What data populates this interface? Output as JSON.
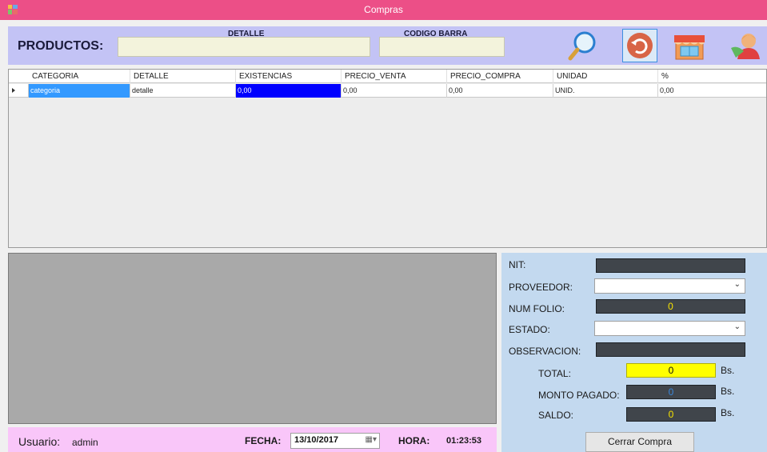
{
  "window": {
    "title": "Compras"
  },
  "products": {
    "heading": "PRODUCTOS:",
    "detail_label": "DETALLE",
    "barcode_label": "CODIGO BARRA",
    "detail_value": "",
    "barcode_value": ""
  },
  "toolbar": {
    "icons": [
      "search-icon",
      "back-icon",
      "store-icon",
      "user-icon"
    ]
  },
  "grid": {
    "columns": [
      "CATEGORIA",
      "DETALLE",
      "EXISTENCIAS",
      "PRECIO_VENTA",
      "PRECIO_COMPRA",
      "UNIDAD",
      "%"
    ],
    "rows": [
      [
        "categoria",
        "detalle",
        "0,00",
        "0,00",
        "0,00",
        "UNID.",
        "0,00"
      ]
    ]
  },
  "form": {
    "nit_label": "NIT:",
    "nit_value": "",
    "proveedor_label": "PROVEEDOR:",
    "proveedor_value": "",
    "num_folio_label": "NUM FOLIO:",
    "num_folio_value": "0",
    "estado_label": "ESTADO:",
    "estado_value": "",
    "observacion_label": "OBSERVACION:",
    "observacion_value": "",
    "total_label": "TOTAL:",
    "total_value": "0",
    "monto_label": "MONTO PAGADO:",
    "monto_value": "0",
    "saldo_label": "SALDO:",
    "saldo_value": "0",
    "currency": "Bs.",
    "close_button": "Cerrar Compra"
  },
  "footer": {
    "user_label": "Usuario:",
    "user_value": "admin",
    "date_label": "FECHA:",
    "date_value": "13/10/2017",
    "time_label": "HORA:",
    "time_value": "01:23:53"
  },
  "colors": {
    "titlebar": "#ec4f87",
    "products_bar": "#c3c3f5",
    "footer_bar": "#f9c6f9",
    "form_panel": "#c3d9ef",
    "selected_cell": "#3399ff",
    "highlight_cell": "#0000ff",
    "total_field": "#ffff00"
  }
}
